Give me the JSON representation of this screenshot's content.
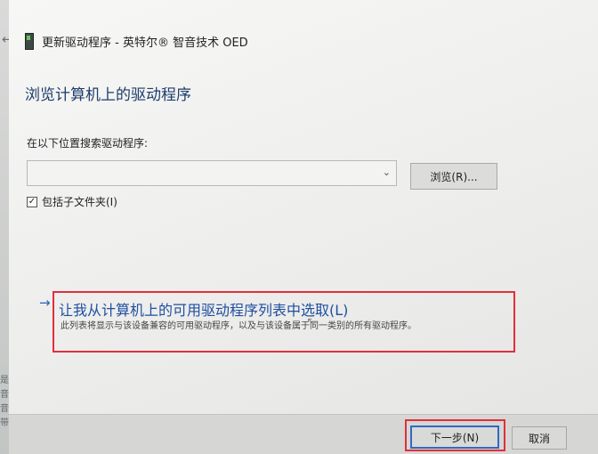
{
  "window": {
    "back_icon": "back-arrow-icon",
    "title": "更新驱动程序 - 英特尔® 智音技术 OED"
  },
  "page": {
    "heading": "浏览计算机上的驱动程序",
    "search_label": "在以下位置搜索驱动程序:",
    "path_value": "",
    "browse_label": "浏览(R)...",
    "include_subfolders_label": "包括子文件夹(I)",
    "include_subfolders_checked": true
  },
  "pick_option": {
    "arrow": "→",
    "title": "让我从计算机上的可用驱动程序列表中选取(L)",
    "description": "此列表将显示与该设备兼容的可用驱动程序，以及与该设备属于同一类别的所有驱动程序。"
  },
  "footer": {
    "next_label": "下一步(N)",
    "cancel_label": "取消"
  },
  "left_strip_chars": [
    "是",
    "音",
    "音",
    "带"
  ],
  "colors": {
    "highlight": "#e0303a",
    "link": "#1f4fa0",
    "heading": "#1d3d6a"
  }
}
